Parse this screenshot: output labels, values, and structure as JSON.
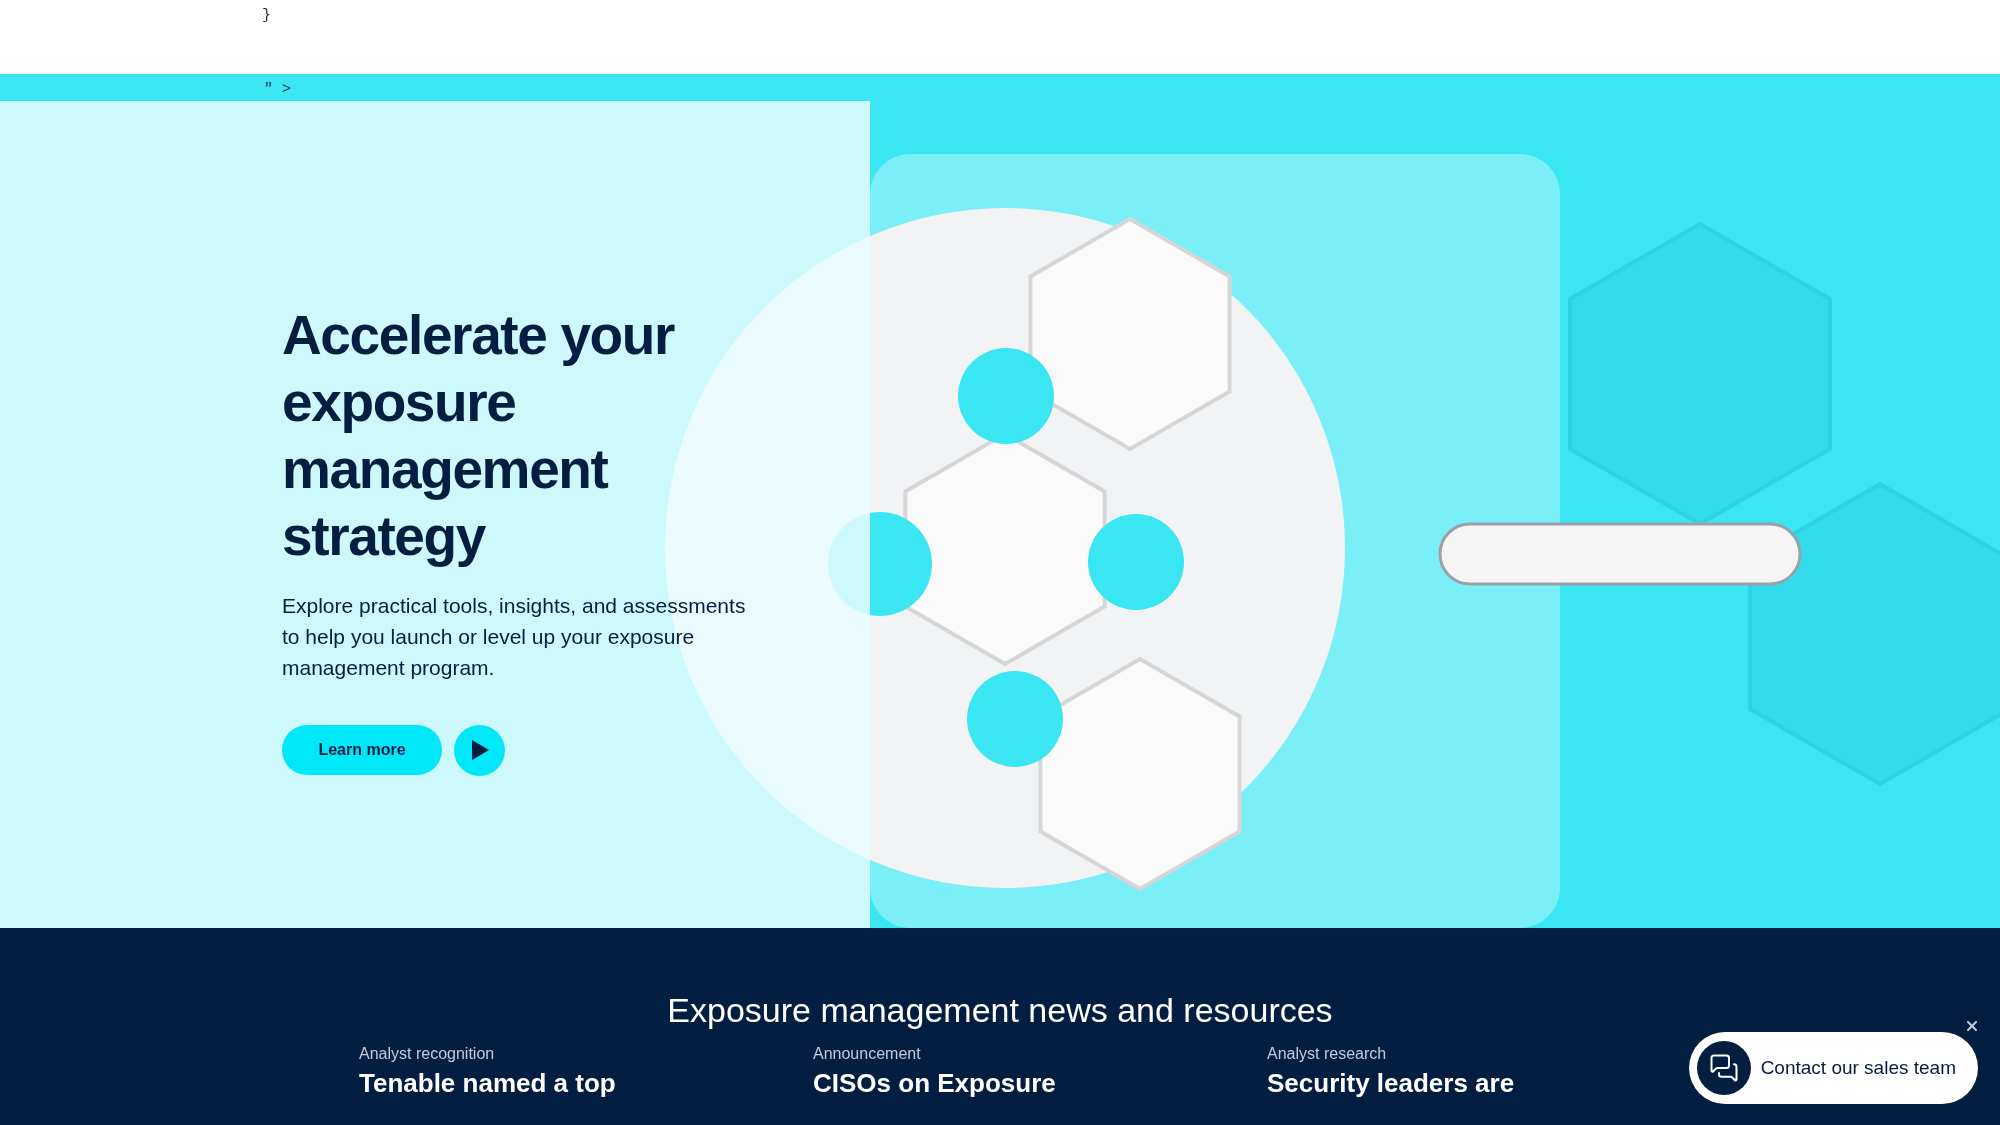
{
  "code_fragments": [
    "}",
    "\" >"
  ],
  "hero": {
    "kind": "picture",
    "heading": "Accelerate your exposure management strategy",
    "description": "Explore practical tools, insights, and assessments to help you launch or level up your exposure management program.",
    "primary_button": "Learn more"
  },
  "news": {
    "title": "Exposure management news and resources",
    "cards": [
      {
        "category": "Analyst recognition",
        "title": "Tenable named a top"
      },
      {
        "category": "Announcement",
        "title": "CISOs on Exposure"
      },
      {
        "category": "Analyst research",
        "title": "Security leaders are"
      }
    ]
  },
  "contact_widget": {
    "label": "Contact our sales team"
  }
}
